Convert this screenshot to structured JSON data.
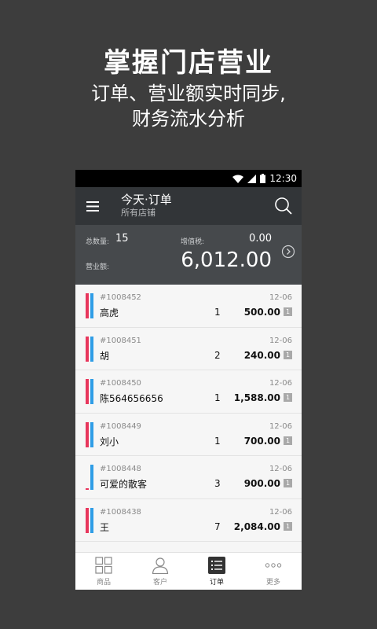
{
  "promo": {
    "title": "掌握门店营业",
    "subtitle_line1": "订单、营业额实时同步,",
    "subtitle_line2": "财务流水分析"
  },
  "statusbar": {
    "time": "12:30"
  },
  "appbar": {
    "title": "今天·订单",
    "subtitle": "所有店铺"
  },
  "summary": {
    "count_label": "总数量:",
    "count": "15",
    "tax_label": "增值税:",
    "tax": "0.00",
    "revenue_label": "营业额:",
    "revenue": "6,012.00"
  },
  "orders": [
    {
      "id": "#1008452",
      "name": "高虎",
      "qty": "1",
      "date": "12-06",
      "amount": "500.00",
      "badge": "1"
    },
    {
      "id": "#1008451",
      "name": "胡",
      "qty": "2",
      "date": "12-06",
      "amount": "240.00",
      "badge": "1"
    },
    {
      "id": "#1008450",
      "name": "陈564656656",
      "qty": "1",
      "date": "12-06",
      "amount": "1,588.00",
      "badge": "1"
    },
    {
      "id": "#1008449",
      "name": "刘小",
      "qty": "1",
      "date": "12-06",
      "amount": "700.00",
      "badge": "1"
    },
    {
      "id": "#1008448",
      "name": "可爱的散客",
      "qty": "3",
      "date": "12-06",
      "amount": "900.00",
      "badge": "1"
    },
    {
      "id": "#1008438",
      "name": "王",
      "qty": "7",
      "date": "12-06",
      "amount": "2,084.00",
      "badge": "1"
    }
  ],
  "tabs": [
    {
      "label": "商品",
      "icon": "grid-icon"
    },
    {
      "label": "客户",
      "icon": "person-icon"
    },
    {
      "label": "订单",
      "icon": "list-icon",
      "active": true
    },
    {
      "label": "更多",
      "icon": "more-dots-icon"
    }
  ],
  "colors": {
    "accent_red": "#e8365c",
    "accent_blue": "#2f9de6",
    "background": "#3d3d3d",
    "appbar": "#323538"
  }
}
